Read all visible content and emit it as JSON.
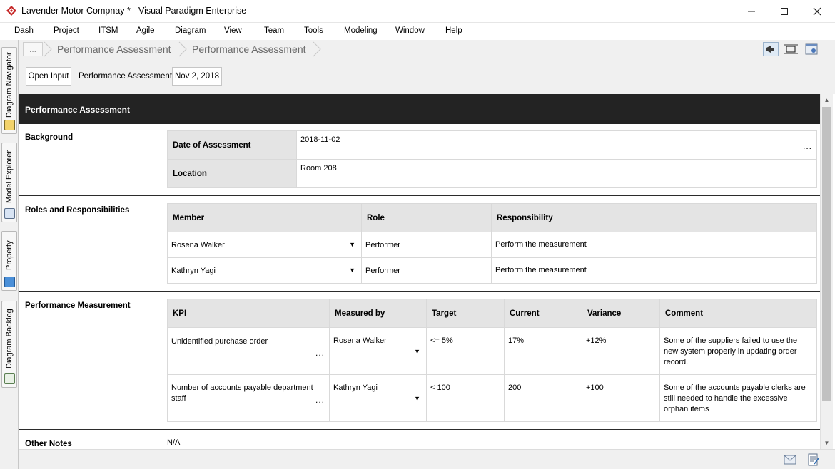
{
  "window": {
    "title": "Lavender Motor Compnay * - Visual Paradigm Enterprise",
    "minimize_glyph": "—",
    "maximize_glyph": "☐",
    "close_glyph": "✕"
  },
  "menu": [
    "Dash",
    "Project",
    "ITSM",
    "Agile",
    "Diagram",
    "View",
    "Team",
    "Tools",
    "Modeling",
    "Window",
    "Help"
  ],
  "side_tabs": [
    "Diagram Navigator",
    "Model Explorer",
    "Property",
    "Diagram Backlog"
  ],
  "breadcrumb": {
    "ellipsis": "...",
    "items": [
      "Performance Assessment",
      "Performance Assessment"
    ]
  },
  "toolbar_icons": [
    "announce-icon",
    "fit-diagram-icon",
    "diagram-settings-icon"
  ],
  "input_bar": {
    "open_input_label": "Open Input",
    "form_label": "Performance Assessment:",
    "date_value": "Nov 2, 2018"
  },
  "document": {
    "header": "Performance Assessment",
    "background": {
      "title": "Background",
      "rows": [
        {
          "label": "Date of Assessment",
          "value": "2018-11-02",
          "more": "..."
        },
        {
          "label": "Location",
          "value": "Room 208"
        }
      ]
    },
    "roles": {
      "title": "Roles and Responsibilities",
      "columns": [
        "Member",
        "Role",
        "Responsibility"
      ],
      "rows": [
        {
          "member": "Rosena Walker",
          "role": "Performer",
          "responsibility": "Perform the measurement"
        },
        {
          "member": "Kathryn Yagi",
          "role": "Performer",
          "responsibility": "Perform the measurement"
        }
      ],
      "dropdown_glyph": "▼"
    },
    "measurement": {
      "title": "Performance Measurement",
      "columns": [
        "KPI",
        "Measured by",
        "Target",
        "Current",
        "Variance",
        "Comment"
      ],
      "rows": [
        {
          "kpi": "Unidentified purchase order",
          "measured_by": "Rosena Walker",
          "target": "<= 5%",
          "current": "17%",
          "variance": "+12%",
          "comment": "Some of the suppliers failed to use the new system properly in updating order record."
        },
        {
          "kpi": "Number of accounts payable department staff",
          "measured_by": "Kathryn Yagi",
          "target": "< 100",
          "current": "200",
          "variance": "+100",
          "comment": "Some of the accounts payable clerks are still needed to handle the excessive orphan items"
        }
      ],
      "more": "...",
      "dropdown_glyph": "▼"
    },
    "other_notes": {
      "title": "Other Notes",
      "value": "N/A"
    }
  },
  "scrollbar": {
    "up": "▲",
    "down": "▼"
  },
  "status_icons": [
    "mail-icon",
    "notes-icon"
  ]
}
